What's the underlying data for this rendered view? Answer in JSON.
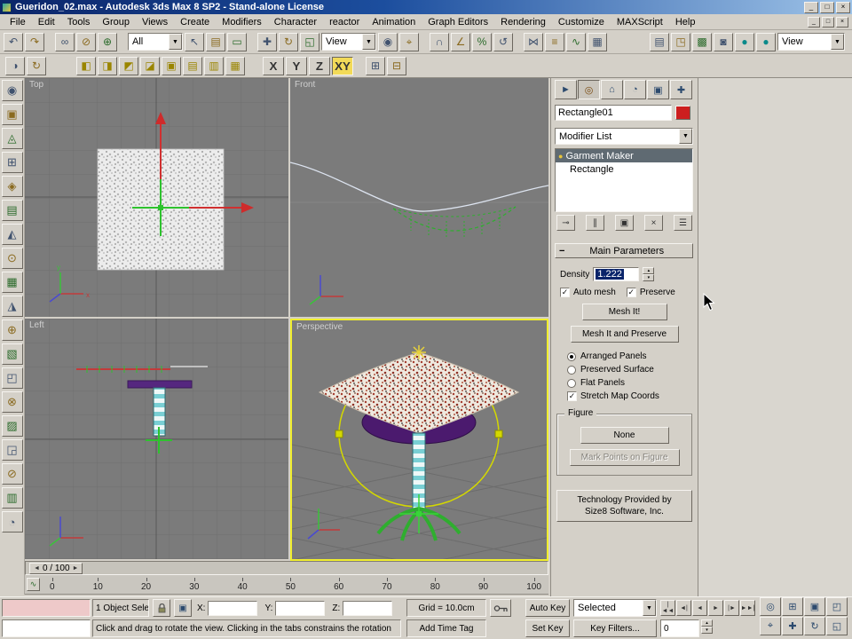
{
  "window": {
    "title": "Gueridon_02.max - Autodesk 3ds Max 8 SP2 - Stand-alone License",
    "controls": [
      "_",
      "□",
      "×"
    ]
  },
  "menubar": {
    "items": [
      "File",
      "Edit",
      "Tools",
      "Group",
      "Views",
      "Create",
      "Modifiers",
      "Character",
      "reactor",
      "Animation",
      "Graph Editors",
      "Rendering",
      "Customize",
      "MAXScript",
      "Help"
    ],
    "controls": [
      "_",
      "□",
      "×"
    ]
  },
  "toolbar_main": {
    "undo_redo": [
      "↶",
      "↷"
    ],
    "link_icons": [
      "∞",
      "⊘",
      "⊕"
    ],
    "selection_filter": "All",
    "select_icons": [
      "↖",
      "▤",
      "▭"
    ],
    "transform_icons": [
      "✚",
      "↻",
      "◱"
    ],
    "ref_coord": "View",
    "center_icons": [
      "◉",
      "⌖"
    ],
    "snap_icons": [
      "∩",
      "∠",
      "%",
      "↺"
    ],
    "tool_icons": [
      "⋈",
      "≡",
      "∿",
      "▦"
    ],
    "render_icons": [
      "▤",
      "◳",
      "▩",
      "◙"
    ],
    "teapot_icons": [
      "●",
      "●"
    ],
    "view_selector": "View",
    "dropdown_arrow": "▼"
  },
  "toolbar_snap": {
    "left_icons": [
      "◑",
      "↻"
    ],
    "mode_icons": [
      "◧",
      "◨",
      "◩",
      "◪",
      "▣",
      "▤",
      "▥",
      "▦"
    ],
    "axis_buttons": [
      "X",
      "Y",
      "Z"
    ],
    "axis_active": "XY",
    "right_icons": [
      "⊞",
      "⊟"
    ]
  },
  "reactor_toolbar": {
    "icons": [
      "◉",
      "▣",
      "◬",
      "⊞",
      "◈",
      "▤",
      "◭",
      "⊙",
      "▦",
      "◮",
      "⊕",
      "▧",
      "◰",
      "⊗",
      "▨",
      "◲",
      "⊘",
      "▥",
      "◔"
    ]
  },
  "viewports": {
    "top": "Top",
    "front": "Front",
    "left": "Left",
    "perspective": "Perspective"
  },
  "command_panel": {
    "tabs": [
      "►",
      "◎",
      "⌂",
      "◔",
      "▣",
      "✚"
    ],
    "object_name": "Rectangle01",
    "modifier_list": "Modifier List",
    "modifier_selected": "Garment Maker",
    "modifier_base": "Rectangle",
    "bulb_icon": "●",
    "stack_buttons": [
      "⊸",
      "∥",
      "▣",
      "×",
      "☰"
    ],
    "rollout_collapse": "−",
    "rollout_title": "Main Parameters",
    "density_label": "Density",
    "density_value": "1.222",
    "spinner_up": "▴",
    "spinner_down": "▾",
    "check_glyph": "✓",
    "auto_mesh": "Auto mesh",
    "preserve": "Preserve",
    "mesh_it": "Mesh It!",
    "mesh_it_preserve": "Mesh It and Preserve",
    "radio_options": [
      "Arranged Panels",
      "Preserved Surface",
      "Flat Panels"
    ],
    "stretch_map": "Stretch Map Coords",
    "figure_title": "Figure",
    "none_button": "None",
    "mark_points": "Mark Points on Figure",
    "tech_line1": "Technology Provided by",
    "tech_line2": "Size8 Software, Inc."
  },
  "time_slider": {
    "value": "0 / 100",
    "prev": "◄",
    "next": "►",
    "trackbar_button": "∿"
  },
  "track_bar": {
    "ticks": [
      "0",
      "10",
      "20",
      "30",
      "40",
      "50",
      "60",
      "70",
      "80",
      "90",
      "100"
    ]
  },
  "status_bar": {
    "selection_status": "1 Object Sele",
    "xyz_labels": [
      "X:",
      "Y:",
      "Z:"
    ],
    "grid_size": "Grid = 10.0cm",
    "prompt": "Click and drag to rotate the view. Clicking in the tabs constrains the rotation",
    "add_time_tag": "Add Time Tag"
  },
  "animation_controls": {
    "auto_key": "Auto Key",
    "set_key": "Set Key",
    "key_mode": "Selected",
    "key_filters": "Key Filters...",
    "frame_value": "0",
    "playback_icons": [
      "|◄◄",
      "◄|",
      "◄",
      "►",
      "|►",
      "►►|"
    ],
    "nav_icons": [
      "◎",
      "⊞",
      "▣",
      "◰",
      "⌖",
      "✚",
      "↻",
      "◱"
    ]
  }
}
